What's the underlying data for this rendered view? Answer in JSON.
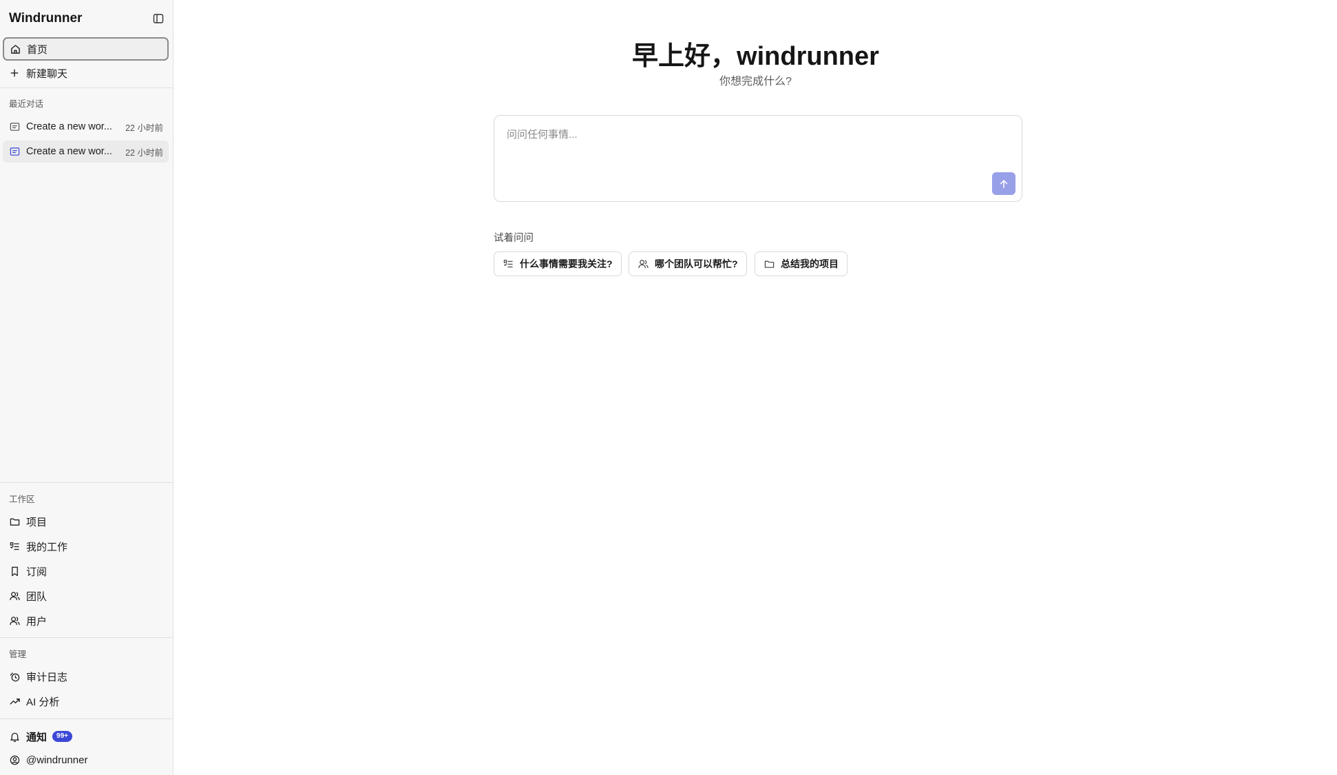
{
  "sidebar": {
    "brand": "Windrunner",
    "nav": {
      "home": "首页",
      "new_chat": "新建聊天"
    },
    "recent_label": "最近对话",
    "recent": [
      {
        "title": "Create a new wor...",
        "time": "22 小时前"
      },
      {
        "title": "Create a new wor...",
        "time": "22 小时前"
      }
    ],
    "workspace_label": "工作区",
    "workspace": {
      "projects": "项目",
      "my_work": "我的工作",
      "subscriptions": "订阅",
      "teams": "团队",
      "users": "用户"
    },
    "admin_label": "管理",
    "admin": {
      "audit_log": "审计日志",
      "ai_analytics": "AI 分析"
    },
    "notifications": {
      "label": "通知",
      "badge": "99+"
    },
    "user": "@windrunner"
  },
  "main": {
    "greeting": "早上好，windrunner",
    "subtitle": "你想完成什么?",
    "composer": {
      "placeholder": "问问任何事情..."
    },
    "try_label": "试着问问",
    "suggestions": [
      {
        "label": "什么事情需要我关注?",
        "icon": "list-check-icon"
      },
      {
        "label": "哪个团队可以帮忙?",
        "icon": "users-icon"
      },
      {
        "label": "总结我的项目",
        "icon": "folder-icon"
      }
    ]
  },
  "colors": {
    "accent": "#3b48d6",
    "send_button": "#98a0e8",
    "sidebar_bg": "#f7f7f7"
  }
}
